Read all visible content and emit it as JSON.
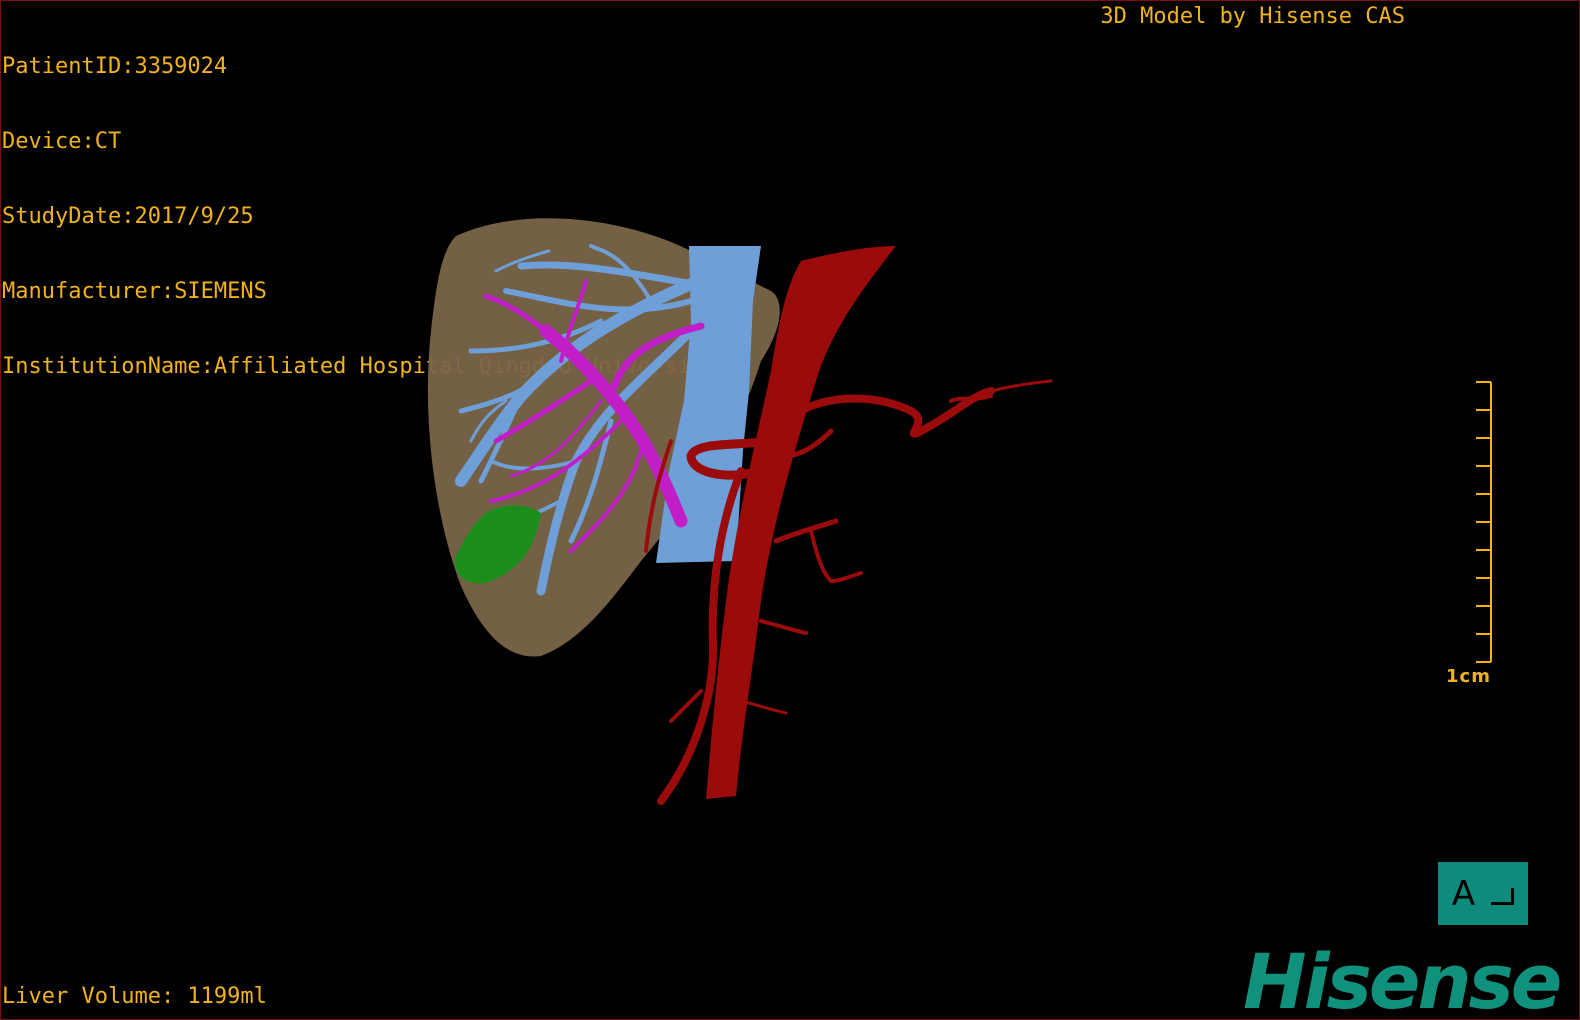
{
  "patient_info": {
    "patient_id": "PatientID:3359024",
    "device": "Device:CT",
    "study_date": "StudyDate:2017/9/25",
    "manufacturer": "Manufacturer:SIEMENS",
    "institution": "InstitutionName:Affiliated Hospital Qingdao University-C"
  },
  "watermark": "3D Model by Hisense CAS",
  "liver_volume": "Liver Volume: 1199ml",
  "scale": {
    "label": "1cm",
    "ticks": 10
  },
  "orientation": {
    "letter": "A",
    "icon": "orientation-corner-icon"
  },
  "brand": "Hisense",
  "colors": {
    "overlay_text": "#f2b21b",
    "liver": "#7a6548",
    "hepatic_vein": "#6f9fd8",
    "portal_vein": "#c21ec8",
    "artery": "#9b0b0b",
    "tumor": "#1b8d1b",
    "brand": "#10917e"
  }
}
